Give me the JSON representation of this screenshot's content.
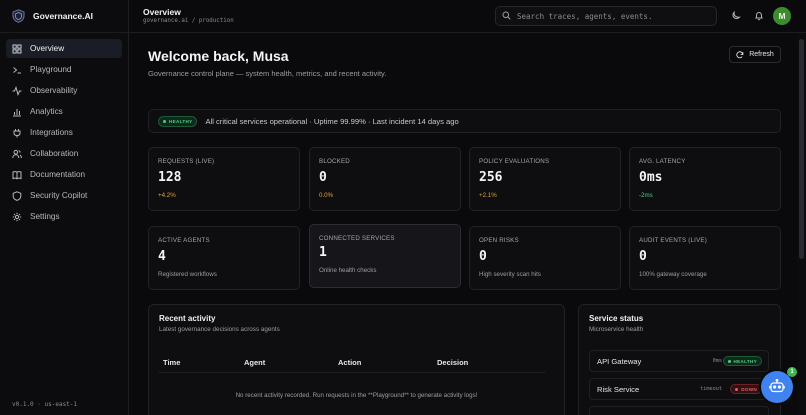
{
  "app": {
    "name": "Governance.AI",
    "version": "v0.1.0 · us-east-1"
  },
  "sidebar": {
    "items": [
      {
        "label": "Overview",
        "icon": "grid-icon",
        "active": true
      },
      {
        "label": "Playground",
        "icon": "terminal-icon"
      },
      {
        "label": "Observability",
        "icon": "activity-icon"
      },
      {
        "label": "Analytics",
        "icon": "chart-icon"
      },
      {
        "label": "Integrations",
        "icon": "plug-icon"
      },
      {
        "label": "Collaboration",
        "icon": "users-icon"
      },
      {
        "label": "Documentation",
        "icon": "book-icon"
      },
      {
        "label": "Security Copilot",
        "icon": "shield-icon"
      },
      {
        "label": "Settings",
        "icon": "gear-icon"
      }
    ]
  },
  "header": {
    "title": "Overview",
    "path": "governance.ai / production",
    "search_placeholder": "Search traces, agents, events.",
    "avatar_initial": "M"
  },
  "main": {
    "welcome": "Welcome back, Musa",
    "subtitle": "Governance control plane — system health, metrics, and recent activity.",
    "refresh_label": "Refresh",
    "health": {
      "badge": "HEALTHY",
      "text": "All critical services operational · Uptime 99.99% · Last incident 14 days ago"
    },
    "metrics": [
      {
        "label": "REQUESTS (LIVE)",
        "value": "128",
        "sub": "+4.2%",
        "tone": "orange"
      },
      {
        "label": "BLOCKED",
        "value": "0",
        "sub": "0.0%",
        "tone": "orange"
      },
      {
        "label": "POLICY EVALUATIONS",
        "value": "256",
        "sub": "+2.1%",
        "tone": "orange"
      },
      {
        "label": "AVG. LATENCY",
        "value": "0ms",
        "sub": "-2ms",
        "tone": "green"
      },
      {
        "label": "ACTIVE AGENTS",
        "value": "4",
        "sub": "Registered workflows",
        "tone": "muted"
      },
      {
        "label": "CONNECTED SERVICES",
        "value": "1",
        "sub": "Online health checks",
        "tone": "muted"
      },
      {
        "label": "OPEN RISKS",
        "value": "0",
        "sub": "High severity scan hits",
        "tone": "muted"
      },
      {
        "label": "AUDIT EVENTS (LIVE)",
        "value": "0",
        "sub": "100% gateway coverage",
        "tone": "muted"
      }
    ],
    "activity": {
      "title": "Recent activity",
      "subtitle": "Latest governance decisions across agents",
      "columns": [
        "Time",
        "Agent",
        "Action",
        "Decision"
      ],
      "empty": "No recent activity recorded. Run requests in the **Playground** to generate activity logs!"
    },
    "services": {
      "title": "Service status",
      "subtitle": "Microservice health",
      "rows": [
        {
          "name": "API Gateway",
          "latency": "0ms",
          "status": "HEALTHY"
        },
        {
          "name": "Risk Service",
          "latency": "timeout",
          "status": "DOWN"
        }
      ]
    }
  },
  "fab": {
    "count": "1"
  },
  "colors": {
    "accent": "#3f82f0",
    "healthy": "#4ed07f",
    "down": "#ee5a5f",
    "delta": "#e0a23c",
    "avatar": "#3d8b2f"
  }
}
